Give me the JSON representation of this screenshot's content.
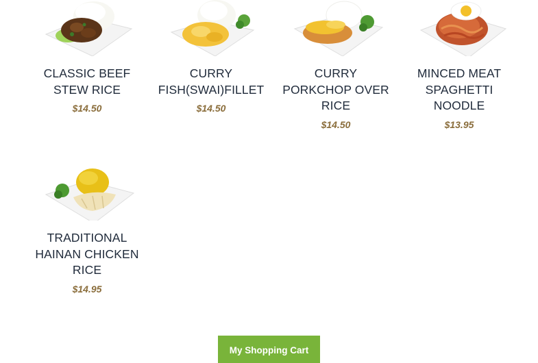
{
  "menu": {
    "items": [
      {
        "name": "CLASSIC BEEF STEW RICE",
        "price": "$14.50",
        "image_icon": "beef-stew-rice-plate-icon"
      },
      {
        "name": "CURRY FISH(SWAI)FILLET",
        "price": "$14.50",
        "image_icon": "curry-fish-plate-icon"
      },
      {
        "name": "CURRY PORKCHOP OVER RICE",
        "price": "$14.50",
        "image_icon": "curry-porkchop-plate-icon"
      },
      {
        "name": "MINCED MEAT SPAGHETTI NOODLE",
        "price": "$13.95",
        "image_icon": "spaghetti-plate-icon"
      },
      {
        "name": "TRADITIONAL HAINAN CHICKEN RICE",
        "price": "$14.95",
        "image_icon": "hainan-chicken-rice-plate-icon"
      }
    ]
  },
  "cart": {
    "label": "My Shopping Cart",
    "color": "#79b43a"
  },
  "colors": {
    "price": "#8a6d3b",
    "title": "#1f2a3a"
  }
}
